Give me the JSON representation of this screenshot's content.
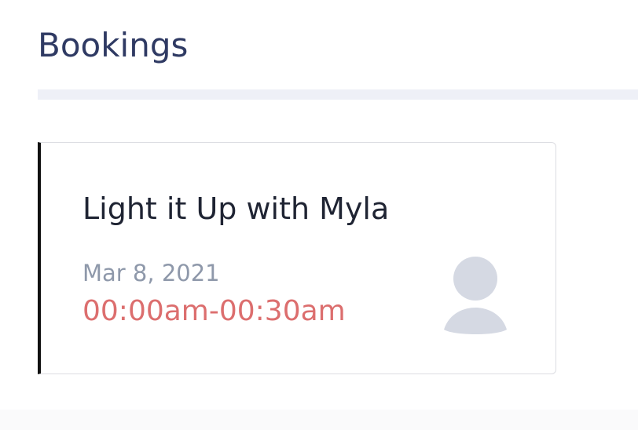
{
  "header": {
    "title": "Bookings"
  },
  "booking": {
    "event_title": "Light it Up with Myla",
    "date": "Mar 8, 2021",
    "time_range": "00:00am-00:30am",
    "avatar_icon": "user-placeholder-icon"
  },
  "colors": {
    "title": "#2f3a63",
    "date": "#8e98aa",
    "time": "#dc6e6e",
    "card_accent": "#111111",
    "divider": "#eef0f7",
    "avatar": "#d5d9e3"
  }
}
